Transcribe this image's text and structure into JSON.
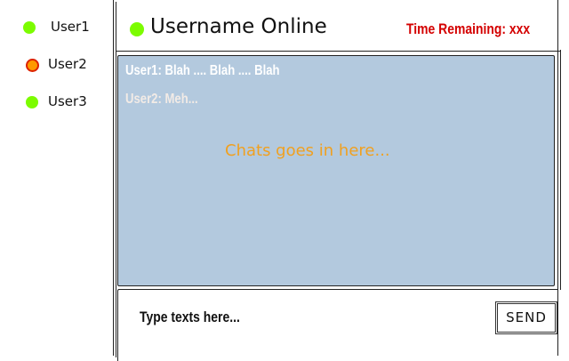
{
  "sidebar": {
    "users": [
      {
        "name": "User1",
        "status": "online",
        "color": "#7cfc00"
      },
      {
        "name": "User2",
        "status": "away",
        "color": "#ff9900",
        "ring": "#dd2200"
      },
      {
        "name": "User3",
        "status": "online",
        "color": "#7cfc00"
      }
    ]
  },
  "header": {
    "title": "Username Online",
    "status_color": "#7cfc00",
    "time_remaining": "Time Remaining: xxx",
    "time_color": "#d40000"
  },
  "chat": {
    "background": "#b3c9de",
    "messages": [
      {
        "text": "User1: Blah .... Blah .... Blah"
      },
      {
        "text": "User2: Meh..."
      }
    ],
    "placeholder": "Chats goes in here...",
    "placeholder_color": "#f0a020"
  },
  "composer": {
    "placeholder": "Type texts here...",
    "send_label": "SEND"
  }
}
